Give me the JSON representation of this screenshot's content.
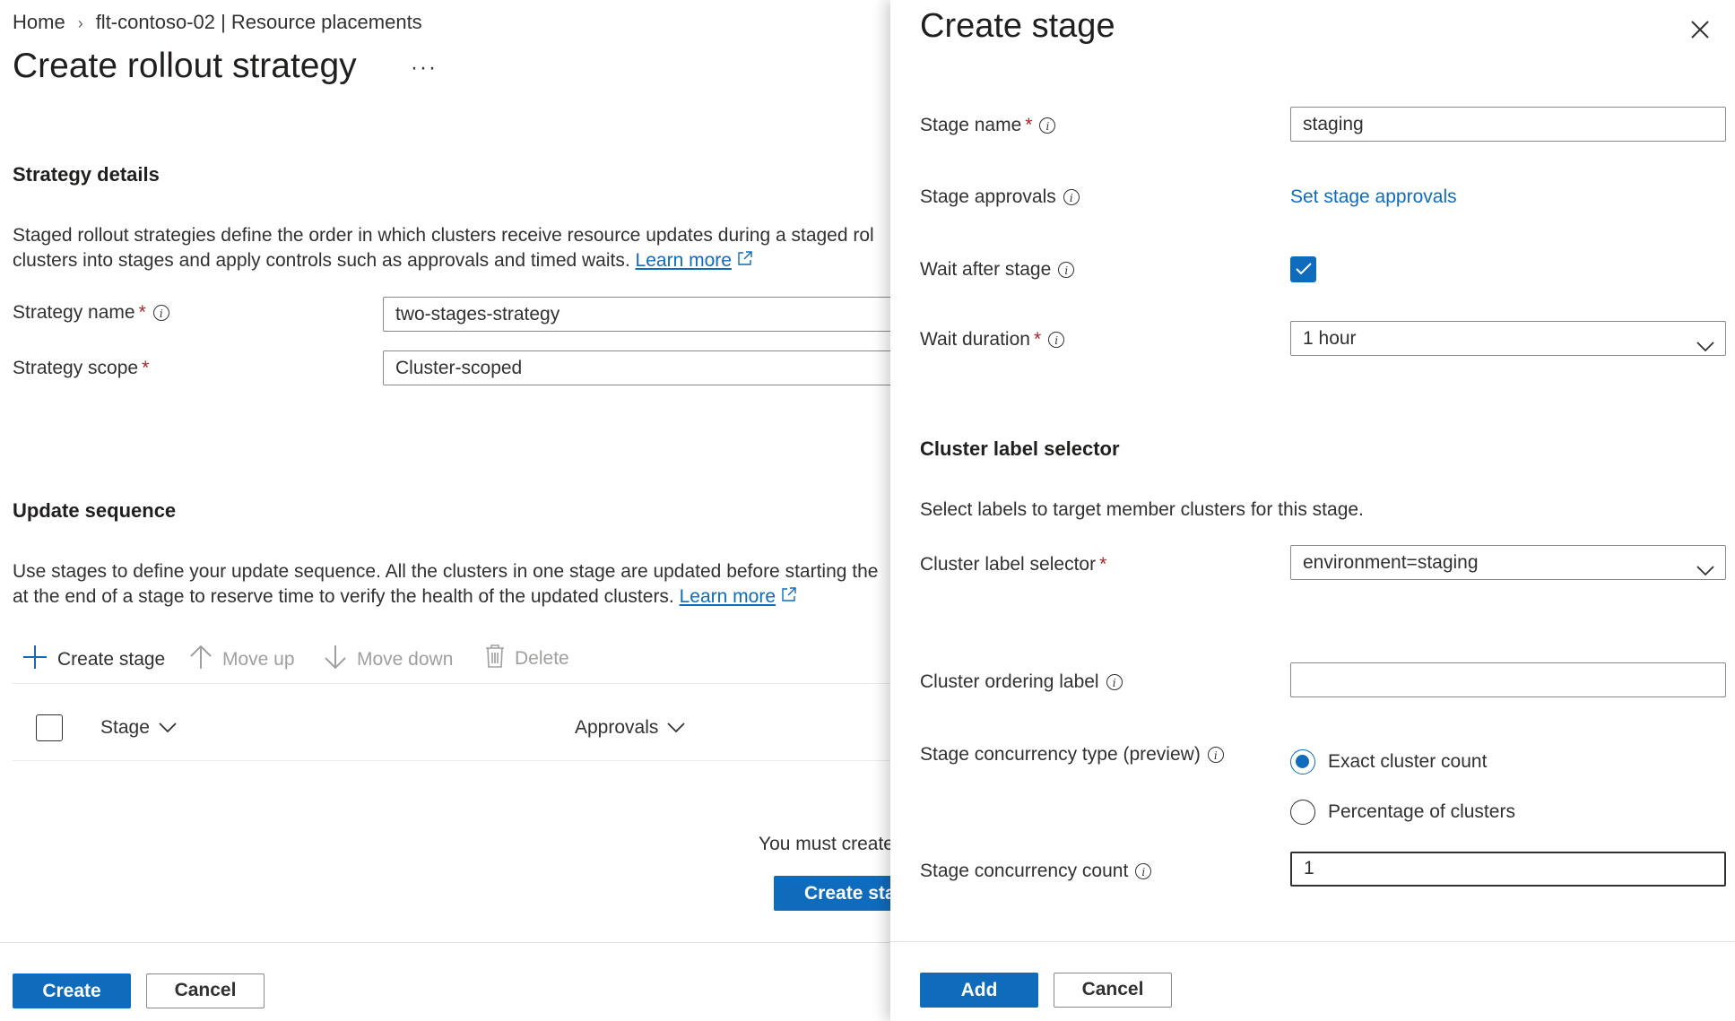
{
  "breadcrumb": {
    "items": [
      "Home",
      "flt-contoso-02 | Resource placements"
    ],
    "separator": "›"
  },
  "page": {
    "title": "Create rollout strategy",
    "more": "···"
  },
  "strategy_details": {
    "heading": "Strategy details",
    "description_line1": "Staged rollout strategies define the order in which clusters receive resource updates during a staged rol",
    "description_line2": "clusters into stages and apply controls such as approvals and timed waits.",
    "learn_more": "Learn more",
    "strategy_name_label": "Strategy name",
    "strategy_name_value": "two-stages-strategy",
    "strategy_scope_label": "Strategy scope",
    "strategy_scope_value": "Cluster-scoped",
    "required_mark": "*"
  },
  "update_sequence": {
    "heading": "Update sequence",
    "description_line1": "Use stages to define your update sequence. All the clusters in one stage are updated before starting the",
    "description_line2": "at the end of a stage to reserve time to verify the health of the updated clusters.",
    "learn_more": "Learn more",
    "toolbar": {
      "create_stage": "Create stage",
      "move_up": "Move up",
      "move_down": "Move down",
      "delete": "Delete"
    },
    "columns": {
      "stage": "Stage",
      "approvals": "Approvals"
    },
    "empty_text": "You must create",
    "empty_button": "Create sta"
  },
  "footer": {
    "create": "Create",
    "cancel": "Cancel"
  },
  "panel": {
    "title": "Create stage",
    "stage_name_label": "Stage name",
    "stage_name_value": "staging",
    "stage_approvals_label": "Stage approvals",
    "stage_approvals_link": "Set stage approvals",
    "wait_after_stage_label": "Wait after stage",
    "wait_after_stage_checked": true,
    "wait_duration_label": "Wait duration",
    "wait_duration_value": "1 hour",
    "cluster_selector_heading": "Cluster label selector",
    "cluster_selector_description": "Select labels to target member clusters for this stage.",
    "cluster_label_selector_label": "Cluster label selector",
    "cluster_label_selector_value": "environment=staging",
    "cluster_ordering_label": "Cluster ordering label",
    "cluster_ordering_value": "",
    "concurrency_type_label": "Stage concurrency type (preview)",
    "concurrency_options": [
      "Exact cluster count",
      "Percentage of clusters"
    ],
    "concurrency_selected": "Exact cluster count",
    "concurrency_count_label": "Stage concurrency count",
    "concurrency_count_value": "1",
    "add": "Add",
    "cancel": "Cancel",
    "required_mark": "*"
  },
  "colors": {
    "accent": "#0f6cbd",
    "required": "#a4262c",
    "text": "#323130",
    "disabled": "#a19f9d"
  }
}
